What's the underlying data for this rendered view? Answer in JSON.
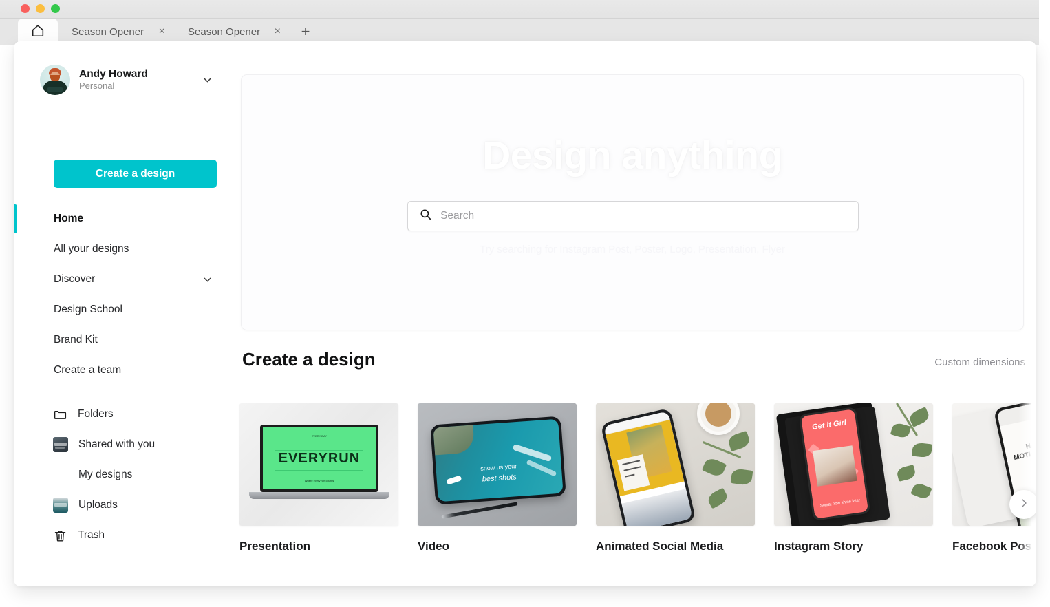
{
  "browser": {
    "home_tab_icon": "home-icon",
    "tabs": [
      {
        "title": "Season Opener",
        "close": "×"
      },
      {
        "title": "Season Opener",
        "close": "×"
      }
    ],
    "new_tab": "+"
  },
  "sidebar": {
    "profile": {
      "name": "Andy Howard",
      "account_type": "Personal",
      "chevron": "chevron-down-icon",
      "avatar": "user-avatar"
    },
    "create_button": "Create a design",
    "nav_primary": [
      {
        "label": "Home",
        "active": true
      },
      {
        "label": "All your designs",
        "active": false
      },
      {
        "label": "Discover",
        "active": false,
        "chevron": "chevron-down-icon"
      },
      {
        "label": "Design School",
        "active": false
      },
      {
        "label": "Brand Kit",
        "active": false
      },
      {
        "label": "Create a team",
        "active": false
      }
    ],
    "nav_secondary": [
      {
        "label": "Folders",
        "icon": "folder-icon"
      },
      {
        "label": "Shared with you",
        "icon": "shared-thumbnail"
      },
      {
        "label": "My designs",
        "icon": "my-designs-thumbnail"
      },
      {
        "label": "Uploads",
        "icon": "uploads-thumbnail"
      },
      {
        "label": "Trash",
        "icon": "trash-icon"
      }
    ]
  },
  "hero": {
    "title": "Design anything",
    "search_placeholder": "Search",
    "search_value": "",
    "search_icon": "search-icon",
    "suggestions_ghost": "Try searching for Instagram Post, Poster, Logo, Presentation, Flyer"
  },
  "create_section": {
    "title": "Create a design",
    "custom_dimensions": "Custom dimensions",
    "cards": [
      {
        "label": "Presentation",
        "thumb": {
          "slide_word": "EVERYRUN",
          "slide_top": "EVERY DAY",
          "slide_bottom": "Where every run counts"
        }
      },
      {
        "label": "Video",
        "thumb": {
          "line1": "show us your",
          "line2": "best shots"
        }
      },
      {
        "label": "Animated Social Media",
        "thumb": {}
      },
      {
        "label": "Instagram Story",
        "thumb": {
          "title": "Get it Girl",
          "bottom": "Sweat now shine later"
        }
      },
      {
        "label": "Facebook Post",
        "thumb": {
          "line1": "HAPPY",
          "line2": "MOTHER'S DAY"
        }
      }
    ],
    "next_arrow": "chevron-right-icon"
  },
  "colors": {
    "brand_teal": "#00c4cc",
    "text_dark": "#18191a",
    "text_muted": "#8e8e93"
  }
}
